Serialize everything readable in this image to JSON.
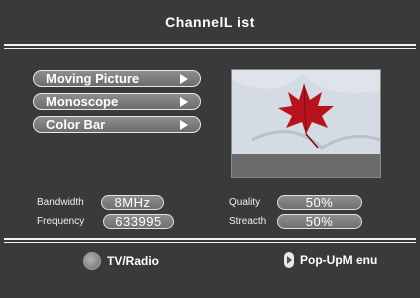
{
  "title": "ChannelL ist",
  "menu": [
    {
      "label": "Moving Picture"
    },
    {
      "label": "Monoscope"
    },
    {
      "label": "Color Bar"
    }
  ],
  "fields": {
    "bandwidth": {
      "label": "Bandwidth",
      "value": "8MHz"
    },
    "frequency": {
      "label": "Frequency",
      "value": "633995"
    },
    "quality": {
      "label": "Quality",
      "value": "50%"
    },
    "strength": {
      "label": "Streacth",
      "value": "50%"
    }
  },
  "footer": {
    "tv_radio": "TV/Radio",
    "popup_menu": "Pop-UpM enu"
  },
  "colors": {
    "background": "#3a3a3a",
    "leaf": "#b8121c"
  }
}
